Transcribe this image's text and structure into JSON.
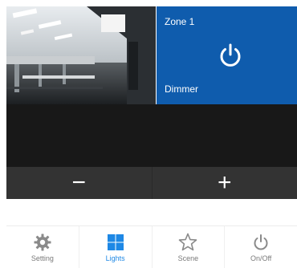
{
  "zone": {
    "title": "Zone 1",
    "mode": "Dimmer",
    "tile_color": "#0f5cad",
    "icon": "power-icon"
  },
  "room_image": {
    "icon": "office-photo"
  },
  "controls": {
    "decrease_label": "−",
    "increase_label": "+"
  },
  "nav": {
    "items": [
      {
        "label": "Setting",
        "icon": "gear-icon",
        "active": false
      },
      {
        "label": "Lights",
        "icon": "windows-grid-icon",
        "active": true
      },
      {
        "label": "Scene",
        "icon": "star-icon",
        "active": false
      },
      {
        "label": "On/Off",
        "icon": "power-icon",
        "active": false
      }
    ],
    "active_color": "#1e88e5"
  }
}
